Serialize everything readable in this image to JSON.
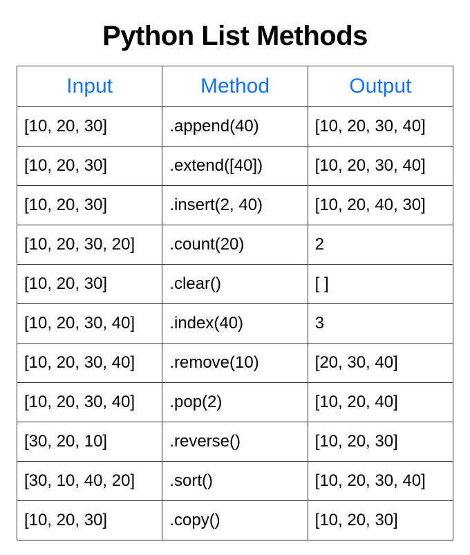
{
  "title": "Python List Methods",
  "headers": {
    "input": "Input",
    "method": "Method",
    "output": "Output"
  },
  "rows": [
    {
      "input": "[10, 20, 30]",
      "method": ".append(40)",
      "output": "[10, 20, 30, 40]"
    },
    {
      "input": "[10, 20, 30]",
      "method": ".extend([40])",
      "output": "[10, 20, 30, 40]"
    },
    {
      "input": "[10, 20, 30]",
      "method": ".insert(2, 40)",
      "output": "[10, 20, 40, 30]"
    },
    {
      "input": "[10, 20, 30, 20]",
      "method": ".count(20)",
      "output": "2"
    },
    {
      "input": "[10, 20, 30]",
      "method": ".clear()",
      "output": "[ ]"
    },
    {
      "input": "[10, 20, 30, 40]",
      "method": ".index(40)",
      "output": "3"
    },
    {
      "input": "[10, 20, 30, 40]",
      "method": ".remove(10)",
      "output": "[20, 30, 40]"
    },
    {
      "input": "[10, 20, 30, 40]",
      "method": ".pop(2)",
      "output": "[10, 20, 40]"
    },
    {
      "input": "[30, 20, 10]",
      "method": ".reverse()",
      "output": "[10, 20, 30]"
    },
    {
      "input": "[30, 10, 40, 20]",
      "method": ".sort()",
      "output": "[10, 20, 30, 40]"
    },
    {
      "input": "[10, 20, 30]",
      "method": ".copy()",
      "output": "[10, 20, 30]"
    }
  ]
}
